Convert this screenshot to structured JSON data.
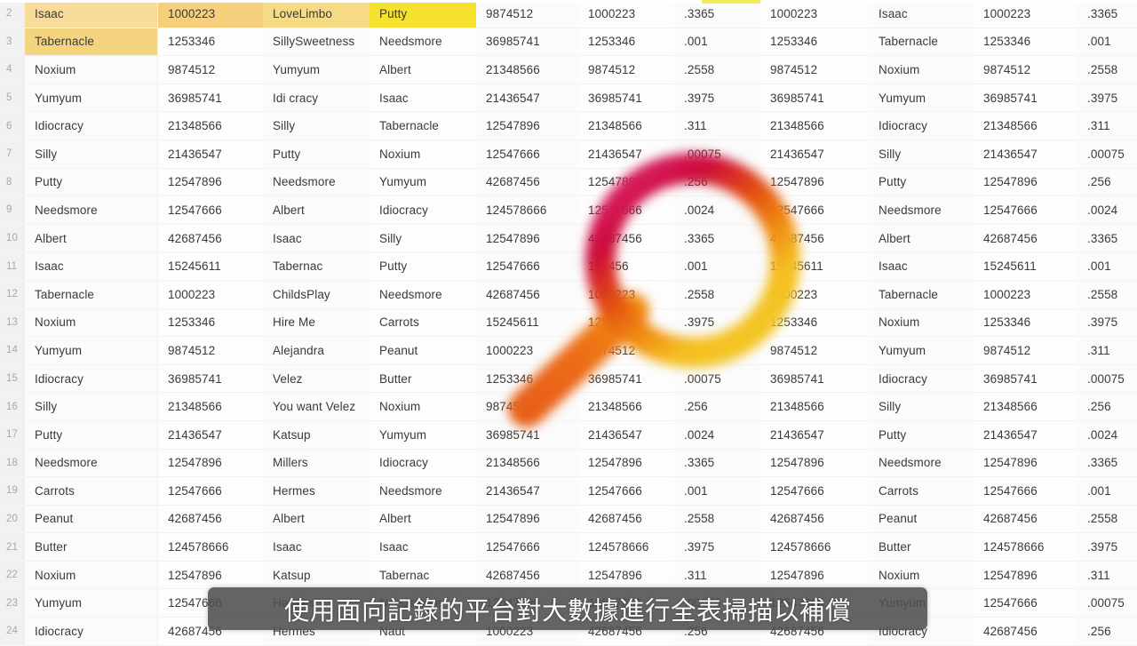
{
  "subtitle": {
    "text": "使用面向記錄的平台對大數據進行全表掃描以補償"
  },
  "colors": {
    "highlight_light": "#f7dc9b",
    "highlight_mid": "#f5cf7c",
    "highlight_strong": "#f6e22e",
    "magnifier_crimson": "#ce0e3f",
    "magnifier_orange": "#ee6a18",
    "magnifier_yellow": "#f4bc20",
    "subtitle_bg": "#4e4e4e",
    "row_number": "#a8a8a8",
    "cell_text": "#3a3a3a"
  },
  "sheet": {
    "row_numbers": [
      "2",
      "3",
      "4",
      "5",
      "6",
      "7",
      "8",
      "9",
      "10",
      "11",
      "12",
      "13",
      "14",
      "15",
      "16",
      "17",
      "18",
      "19",
      "20",
      "21",
      "22",
      "23",
      "24"
    ],
    "rows": [
      [
        "Isaac",
        "1000223",
        "LoveLimbo",
        "Putty",
        "9874512",
        "1000223",
        ".3365",
        "1000223",
        "Isaac",
        "1000223",
        ".3365"
      ],
      [
        "Tabernacle",
        "1253346",
        "SillySweetness",
        "Needsmore",
        "36985741",
        "1253346",
        ".001",
        "1253346",
        "Tabernacle",
        "1253346",
        ".001"
      ],
      [
        "Noxium",
        "9874512",
        "Yumyum",
        "Albert",
        "21348566",
        "9874512",
        ".2558",
        "9874512",
        "Noxium",
        "9874512",
        ".2558"
      ],
      [
        "Yumyum",
        "36985741",
        "Idi  cracy",
        "Isaac",
        "21436547",
        "36985741",
        ".3975",
        "36985741",
        "Yumyum",
        "36985741",
        ".3975"
      ],
      [
        "Idiocracy",
        "21348566",
        "Silly",
        "Tabernacle",
        "12547896",
        "21348566",
        ".311",
        "21348566",
        "Idiocracy",
        "21348566",
        ".311"
      ],
      [
        "Silly",
        "21436547",
        "Putty",
        "Noxium",
        "12547666",
        "21436547",
        ".00075",
        "21436547",
        "Silly",
        "21436547",
        ".00075"
      ],
      [
        "Putty",
        "12547896",
        "Needsmore",
        "Yumyum",
        "42687456",
        "12547896",
        ".256",
        "12547896",
        "Putty",
        "12547896",
        ".256"
      ],
      [
        "Needsmore",
        "12547666",
        "Albert",
        "Idiocracy",
        "124578666",
        "12547666",
        ".0024",
        "12547666",
        "Needsmore",
        "12547666",
        ".0024"
      ],
      [
        "Albert",
        "42687456",
        "Isaac",
        "Silly",
        "12547896",
        "42687456",
        ".3365",
        "42687456",
        "Albert",
        "42687456",
        ".3365"
      ],
      [
        "Isaac",
        "15245611",
        "Tabernac",
        "Putty",
        "12547666",
        "152456",
        ".001",
        "15245611",
        "Isaac",
        "15245611",
        ".001"
      ],
      [
        "Tabernacle",
        "1000223",
        "ChildsPlay",
        "Needsmore",
        "42687456",
        "1000223",
        ".2558",
        "1000223",
        "Tabernacle",
        "1000223",
        ".2558"
      ],
      [
        "Noxium",
        "1253346",
        "Hire Me",
        "Carrots",
        "15245611",
        "1253346",
        ".3975",
        "1253346",
        "Noxium",
        "1253346",
        ".3975"
      ],
      [
        "Yumyum",
        "9874512",
        "Alejandra",
        "Peanut",
        "1000223",
        "9874512",
        ".311",
        "9874512",
        "Yumyum",
        "9874512",
        ".311"
      ],
      [
        "Idiocracy",
        "36985741",
        "Velez",
        "Butter",
        "1253346",
        "36985741",
        ".00075",
        "36985741",
        "Idiocracy",
        "36985741",
        ".00075"
      ],
      [
        "Silly",
        "21348566",
        "You want Velez",
        "Noxium",
        "9874512",
        "21348566",
        ".256",
        "21348566",
        "Silly",
        "21348566",
        ".256"
      ],
      [
        "Putty",
        "21436547",
        "Katsup",
        "Yumyum",
        "36985741",
        "21436547",
        ".0024",
        "21436547",
        "Putty",
        "21436547",
        ".0024"
      ],
      [
        "Needsmore",
        "12547896",
        "Millers",
        "Idiocracy",
        "21348566",
        "12547896",
        ".3365",
        "12547896",
        "Needsmore",
        "12547896",
        ".3365"
      ],
      [
        "Carrots",
        "12547666",
        "Hermes",
        "Needsmore",
        "21436547",
        "12547666",
        ".001",
        "12547666",
        "Carrots",
        "12547666",
        ".001"
      ],
      [
        "Peanut",
        "42687456",
        "Albert",
        "Albert",
        "12547896",
        "42687456",
        ".2558",
        "42687456",
        "Peanut",
        "42687456",
        ".2558"
      ],
      [
        "Butter",
        "124578666",
        "Isaac",
        "Isaac",
        "12547666",
        "124578666",
        ".3975",
        "124578666",
        "Butter",
        "124578666",
        ".3975"
      ],
      [
        "Noxium",
        "12547896",
        "Katsup",
        "Tabernac",
        "42687456",
        "12547896",
        ".311",
        "12547896",
        "Noxium",
        "12547896",
        ".311"
      ],
      [
        "Yumyum",
        "12547666",
        "Hermes",
        "Needsmore",
        "12547896",
        "12547666",
        ".00075",
        "12547666",
        "Yumyum",
        "12547666",
        ".00075"
      ],
      [
        "Idiocracy",
        "42687456",
        "Hermes",
        "Naut",
        "1000223",
        "42687456",
        ".256",
        "42687456",
        "Idiocracy",
        "42687456",
        ".256"
      ]
    ],
    "highlighted_row_index": 0,
    "highlight_classes": [
      "hl1",
      "hl2",
      "hl3",
      "hl4",
      "",
      "",
      "",
      "",
      "",
      "",
      ""
    ],
    "tabernacle_highlight_row_index": 1
  },
  "magnifier": {
    "icon_name": "magnifying-glass-icon",
    "visible_values": [
      ".00075",
      ".0024",
      ".3365",
      ".001",
      ".2558",
      ".3975",
      ".00075"
    ]
  }
}
